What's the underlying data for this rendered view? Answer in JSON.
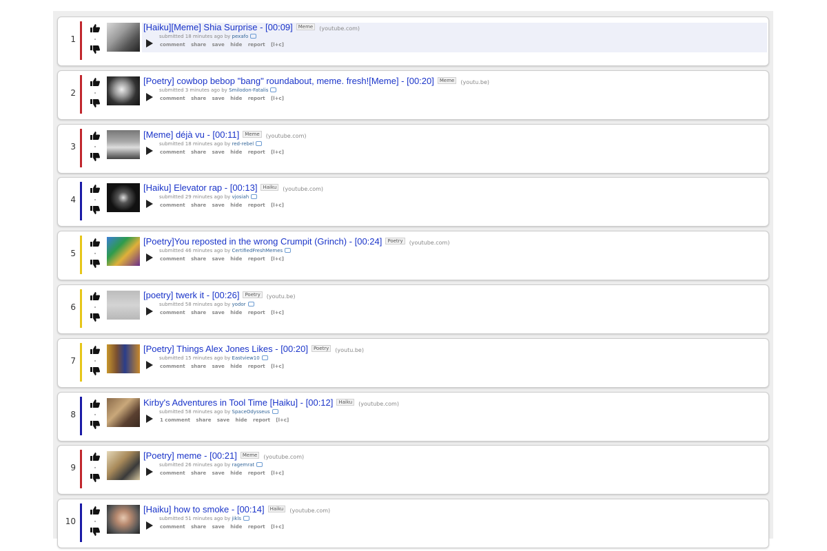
{
  "posts": [
    {
      "rank": "1",
      "title": "[Haiku][Meme] Shia Surprise - [00:09]",
      "flair": "Meme",
      "domain": "(youtube.com)",
      "submitted": "submitted 18 minutes ago by",
      "author": "pexafo",
      "color": "#c1272d",
      "comment": "comment",
      "thumb": "gray"
    },
    {
      "rank": "2",
      "title": "[Poetry] cowbop bebop \"bang\" roundabout, meme. fresh![Meme] - [00:20]",
      "flair": "Meme",
      "domain": "(youtu.be)",
      "submitted": "submitted 3 minutes ago by",
      "author": "Smilodon-Fatalis",
      "color": "#c1272d",
      "comment": "comment",
      "thumb": "bw"
    },
    {
      "rank": "3",
      "title": "[Meme] déjà vu - [00:11]",
      "flair": "Meme",
      "domain": "(youtube.com)",
      "submitted": "submitted 18 minutes ago by",
      "author": "red-rebel",
      "color": "#c1272d",
      "comment": "comment",
      "thumb": "street"
    },
    {
      "rank": "4",
      "title": "[Haiku] Elevator rap - [00:13]",
      "flair": "Haiku",
      "domain": "(youtube.com)",
      "submitted": "submitted 29 minutes ago by",
      "author": "vjosiah",
      "color": "#1a1aa6",
      "comment": "comment",
      "thumb": "dark"
    },
    {
      "rank": "5",
      "title": "[Poetry]You reposted in the wrong Crumpit (Grinch) - [00:24]",
      "flair": "Poetry",
      "domain": "(youtube.com)",
      "submitted": "submitted 46 minutes ago by",
      "author": "CertifiedFreshMemes",
      "color": "#e6c619",
      "comment": "comment",
      "thumb": "cartoon"
    },
    {
      "rank": "6",
      "title": "[poetry] twerk it - [00:26]",
      "flair": "Poetry",
      "domain": "(youtu.be)",
      "submitted": "submitted 58 minutes ago by",
      "author": "yodor",
      "color": "#e6c619",
      "comment": "comment",
      "thumb": "plain"
    },
    {
      "rank": "7",
      "title": "[Poetry] Things Alex Jones Likes - [00:20]",
      "flair": "Poetry",
      "domain": "(youtu.be)",
      "submitted": "submitted 15 minutes ago by",
      "author": "Eastview10",
      "color": "#e6c619",
      "comment": "comment",
      "thumb": "face"
    },
    {
      "rank": "8",
      "title": "Kirby's Adventures in Tool Time [Haiku] - [00:12]",
      "flair": "Haiku",
      "domain": "(youtube.com)",
      "submitted": "submitted 58 minutes ago by",
      "author": "SpaceOdysseus",
      "color": "#1a1aa6",
      "comment": "1 comment",
      "thumb": "room"
    },
    {
      "rank": "9",
      "title": "[Poetry] meme - [00:21]",
      "flair": "Meme",
      "domain": "(youtube.com)",
      "submitted": "submitted 26 minutes ago by",
      "author": "ragemrat",
      "color": "#c1272d",
      "comment": "comment",
      "thumb": "person"
    },
    {
      "rank": "10",
      "title": "[Haiku] how to smoke - [00:14]",
      "flair": "Haiku",
      "domain": "(youtube.com)",
      "submitted": "submitted 51 minutes ago by",
      "author": "jikls",
      "color": "#1a1aa6",
      "comment": "comment",
      "thumb": "old"
    }
  ],
  "buttons": {
    "share": "share",
    "save": "save",
    "hide": "hide",
    "report": "report",
    "expand": "[l+c]"
  },
  "icons": {
    "upvote": "thumbs-up-icon",
    "downvote": "thumbs-down-icon",
    "play": "play-icon",
    "message": "message-icon"
  }
}
